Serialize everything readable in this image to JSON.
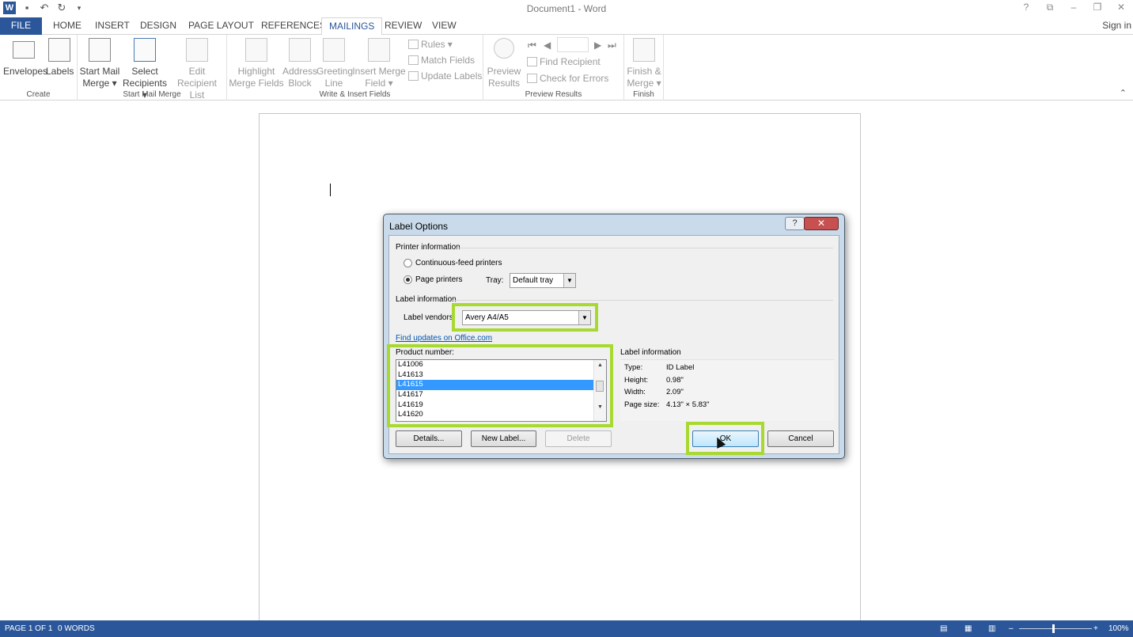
{
  "window": {
    "title": "Document1 - Word",
    "sign_in": "Sign in"
  },
  "tabs": [
    {
      "label": "FILE"
    },
    {
      "label": "HOME"
    },
    {
      "label": "INSERT"
    },
    {
      "label": "DESIGN"
    },
    {
      "label": "PAGE LAYOUT"
    },
    {
      "label": "REFERENCES"
    },
    {
      "label": "MAILINGS"
    },
    {
      "label": "REVIEW"
    },
    {
      "label": "VIEW"
    }
  ],
  "ribbon": {
    "create": {
      "label": "Create",
      "envelopes": "Envelopes",
      "labels": "Labels"
    },
    "start": {
      "label": "Start Mail Merge",
      "start_mail": "Start Mail",
      "merge": "Merge",
      "select": "Select",
      "recipients": "Recipients",
      "edit": "Edit",
      "recipient_list": "Recipient List"
    },
    "write": {
      "label": "Write & Insert Fields",
      "highlight": "Highlight",
      "merge_fields": "Merge Fields",
      "address": "Address",
      "block": "Block",
      "greeting": "Greeting",
      "line": "Line",
      "insert_merge": "Insert Merge",
      "field": "Field",
      "rules": "Rules",
      "match_fields": "Match Fields",
      "update_labels": "Update Labels"
    },
    "preview": {
      "label": "Preview Results",
      "preview": "Preview",
      "results": "Results",
      "find_recipient": "Find Recipient",
      "check_errors": "Check for Errors"
    },
    "finish": {
      "label": "Finish",
      "finish": "Finish &",
      "merge": "Merge"
    }
  },
  "status": {
    "page": "PAGE 1 OF 1",
    "words": "0 WORDS",
    "zoom": "100%"
  },
  "dialog": {
    "title": "Label Options",
    "printer_info": "Printer information",
    "continuous": "Continuous-feed printers",
    "page_printers": "Page printers",
    "tray_label": "Tray:",
    "tray_value": "Default tray",
    "label_info": "Label information",
    "vendors_label": "Label vendors",
    "vendors_value": "Avery A4/A5",
    "find_updates": "Find updates on Office.com",
    "product_number": "Product number:",
    "products": [
      "L41006",
      "L41613",
      "L41615",
      "L41617",
      "L41619",
      "L41620"
    ],
    "selected_product": "L41615",
    "info_title": "Label information",
    "type_label": "Type:",
    "type_value": "ID Label",
    "height_label": "Height:",
    "height_value": "0.98\"",
    "width_label": "Width:",
    "width_value": "2.09\"",
    "pagesize_label": "Page size:",
    "pagesize_value": "4.13\" × 5.83\"",
    "details": "Details...",
    "new_label": "New Label...",
    "delete": "Delete",
    "ok": "OK",
    "cancel": "Cancel"
  },
  "colors": {
    "accent": "#2b579a",
    "highlight": "#a8d930",
    "selection": "#3399ff"
  }
}
